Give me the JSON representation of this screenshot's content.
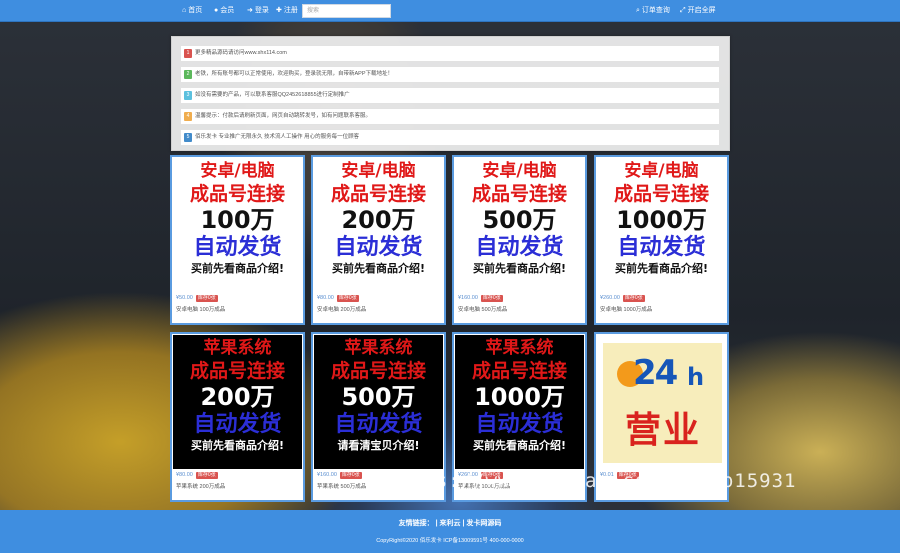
{
  "nav": {
    "home": "首页",
    "member": "会员",
    "login": "登录",
    "register": "注册",
    "search_placeholder": "搜索",
    "order_query": "订单查询",
    "fullscreen": "开启全屏"
  },
  "notices": [
    {
      "num": "1",
      "text": "更多精品源码请访问www.shx114.com",
      "color": "#d9534f"
    },
    {
      "num": "2",
      "text": "老铁，所有账号都可以正常使用，欢迎购买，登录就无限，自带新APP下载地址！",
      "color": "#5cb85c"
    },
    {
      "num": "3",
      "text": "如没有需要的产品，可以联系客服QQ2452618855进行定制推广",
      "color": "#5bc0de"
    },
    {
      "num": "4",
      "text": "温馨提示：付款后请刷新页面，网页自动跳转发号，如有问题联系客服。",
      "color": "#f0ad4e"
    },
    {
      "num": "5",
      "text": "佰乐发卡 专业推广无限永久 技术流人工操作 用心的服务每一位顾客",
      "color": "#428bca"
    }
  ],
  "products": [
    {
      "l1": "安卓/电脑",
      "l2": "成品号连接",
      "l3": "100万",
      "l4": "自动发货",
      "l5": "买前先看商品介绍!",
      "price": "¥50.00",
      "stock": "库存0张",
      "name": "安卓电脑 100万成品"
    },
    {
      "l1": "安卓/电脑",
      "l2": "成品号连接",
      "l3": "200万",
      "l4": "自动发货",
      "l5": "买前先看商品介绍!",
      "price": "¥80.00",
      "stock": "库存0张",
      "name": "安卓电脑 200万成品"
    },
    {
      "l1": "安卓/电脑",
      "l2": "成品号连接",
      "l3": "500万",
      "l4": "自动发货",
      "l5": "买前先看商品介绍!",
      "price": "¥160.00",
      "stock": "库存0张",
      "name": "安卓电脑 500万成品"
    },
    {
      "l1": "安卓/电脑",
      "l2": "成品号连接",
      "l3": "1000万",
      "l4": "自动发货",
      "l5": "买前先看商品介绍!",
      "price": "¥260.00",
      "stock": "库存0张",
      "name": "安卓电脑 1000万成品"
    },
    {
      "l1": "苹果系统",
      "l2": "成品号连接",
      "l3": "200万",
      "l4": "自动发货",
      "l5": "买前先看商品介绍!",
      "price": "¥80.00",
      "stock": "库存0张",
      "name": "苹果系统 200万成品"
    },
    {
      "l1": "苹果系统",
      "l2": "成品号连接",
      "l3": "500万",
      "l4": "自动发货",
      "l5": "请看清宝贝介绍!",
      "price": "¥160.00",
      "stock": "库存0张",
      "name": "苹果系统 500万成品"
    },
    {
      "l1": "苹果系统",
      "l2": "成品号连接",
      "l3": "1000万",
      "l4": "自动发货",
      "l5": "买前先看商品介绍!",
      "price": "¥260.00",
      "stock": "库存0张",
      "name": "苹果系统 1000万成品"
    }
  ],
  "poster": {
    "big": "24",
    "h": "h",
    "text": "营业",
    "price": "¥0.01",
    "stock": "库存0张"
  },
  "watermark": "https://www.huzhan.com/ishop15931",
  "footer": {
    "friend_label": "友情链接：",
    "link1": "来利云",
    "link2": "发卡网源码",
    "copyright": "CopyRight©2020 佰乐发卡   ICP备13009591号   400-000-0000"
  }
}
